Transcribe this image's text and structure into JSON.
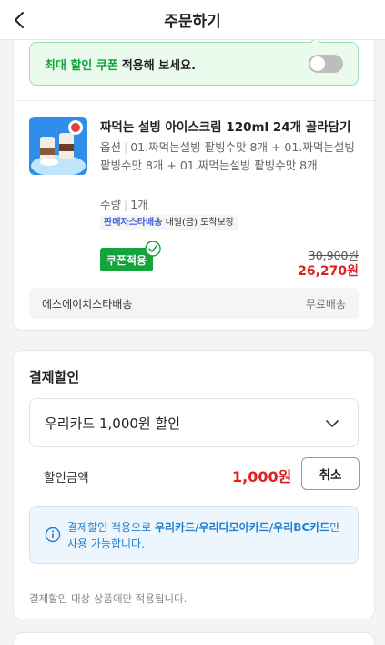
{
  "header": {
    "title": "주문하기"
  },
  "coupon_banner": {
    "highlight": "최대 할인 쿠폰",
    "text": "적용해 보세요.",
    "toggle_on": false
  },
  "product": {
    "title": "짜먹는 설빙 아이스크림 120ml 24개 골라담기",
    "option_label": "옵션",
    "option_value": "01.짜먹는설빙 팥빙수맛 8개 + 01.짜먹는설빙 팥빙수맛 8개 + 01.짜먹는설빙 팥빙수맛 8개",
    "qty_label": "수량",
    "qty_value": "1개",
    "delivery_brand": "판매자스타배송",
    "delivery_text": "내일(금) 도착보장",
    "coupon_badge": "쿠폰적용",
    "original_price": "30,900원",
    "sale_price": "26,270원"
  },
  "shipping": {
    "seller": "에스에이치스타배송",
    "fee": "무료배송"
  },
  "payment_discount": {
    "title": "결제할인",
    "selected_card": "우리카드 1,000원 할인",
    "amount_label": "할인금액",
    "amount": "1,000원",
    "cancel_label": "취소",
    "info_prefix": "결제할인 적용으로",
    "info_cards": "우리카드/우리다모아카드/우리BC카드",
    "info_suffix": "만 사용 가능합니다.",
    "footnote": "결제할인 대상 상품에만 적용됩니다."
  },
  "colors": {
    "green": "#13a43b",
    "red": "#e02020",
    "blue": "#1f7fd0"
  }
}
